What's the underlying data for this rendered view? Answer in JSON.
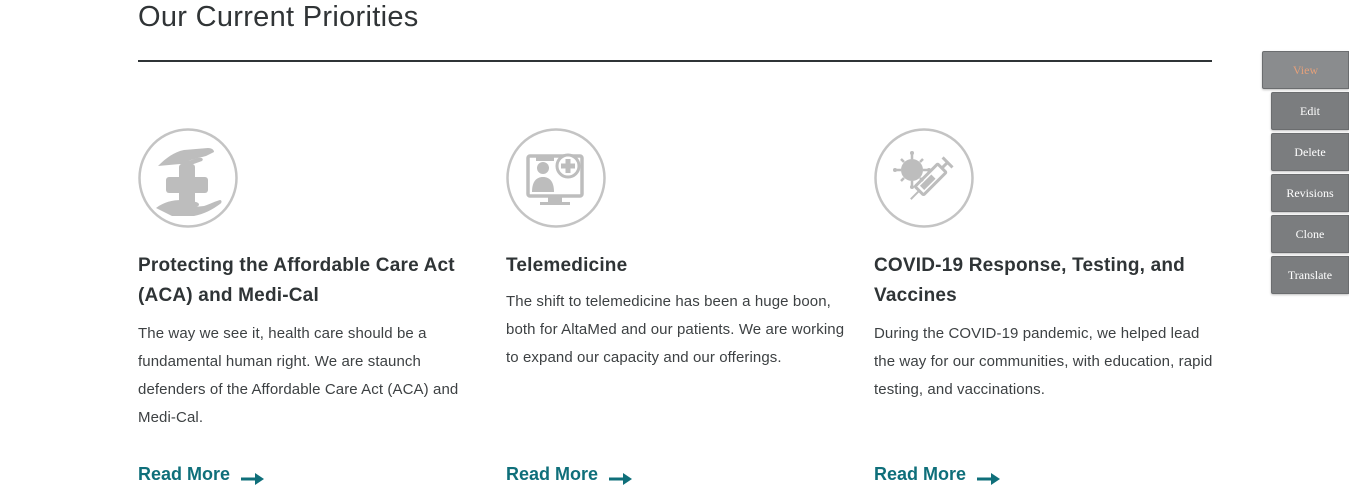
{
  "section": {
    "title": "Our Current Priorities"
  },
  "cards": [
    {
      "icon": "hands-medical-cross-icon",
      "title": "Protecting the Affordable Care Act (ACA) and Medi-Cal",
      "text": "The way we see it, health care should be a fundamental human right. We are staunch defenders of the Affordable Care Act (ACA) and Medi-Cal.",
      "link": "Read More"
    },
    {
      "icon": "telemedicine-monitor-icon",
      "title": "Telemedicine",
      "text": "The shift to telemedicine has been a huge boon, both for AltaMed and our patients. We are working to expand our capacity and our offerings.",
      "link": "Read More"
    },
    {
      "icon": "virus-syringe-icon",
      "title": "COVID-19 Response, Testing, and Vaccines",
      "text": "During the COVID-19 pandemic, we helped lead the way for our communities, with education, rapid testing, and vaccinations.",
      "link": "Read More"
    }
  ],
  "admin_tabs": {
    "view": "View",
    "edit": "Edit",
    "delete": "Delete",
    "revisions": "Revisions",
    "clone": "Clone",
    "translate": "Translate"
  },
  "colors": {
    "link": "#0f6f7a",
    "icon": "#c4c4c4",
    "admin_tab": "#7b7d7f",
    "active_tab_text": "#e5a07a"
  }
}
